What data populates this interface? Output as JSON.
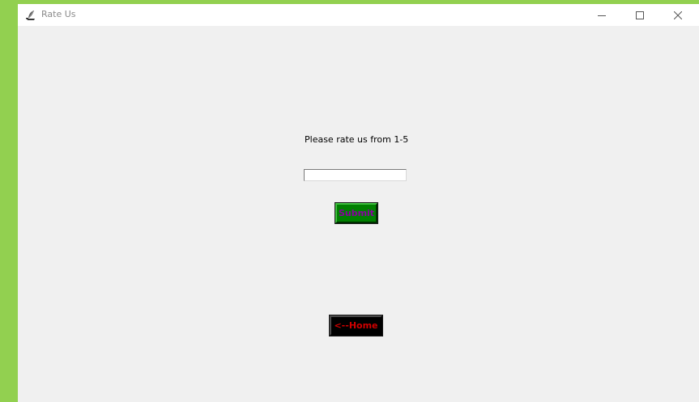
{
  "window": {
    "title": "Rate Us",
    "app_icon": "feather-tk-icon",
    "controls": {
      "minimize_icon": "minimize-icon",
      "maximize_icon": "maximize-icon",
      "close_icon": "close-icon"
    }
  },
  "content": {
    "prompt": "Please rate us from 1-5",
    "rating_input": {
      "value": "",
      "placeholder": ""
    },
    "submit_label": "Submit",
    "home_label": "<--Home"
  },
  "colors": {
    "desktop_background": "#92d050",
    "window_background": "#f0f0f0",
    "submit_background": "#008000",
    "submit_text": "#8a00a0",
    "home_background": "#000000",
    "home_text": "#d00000"
  }
}
